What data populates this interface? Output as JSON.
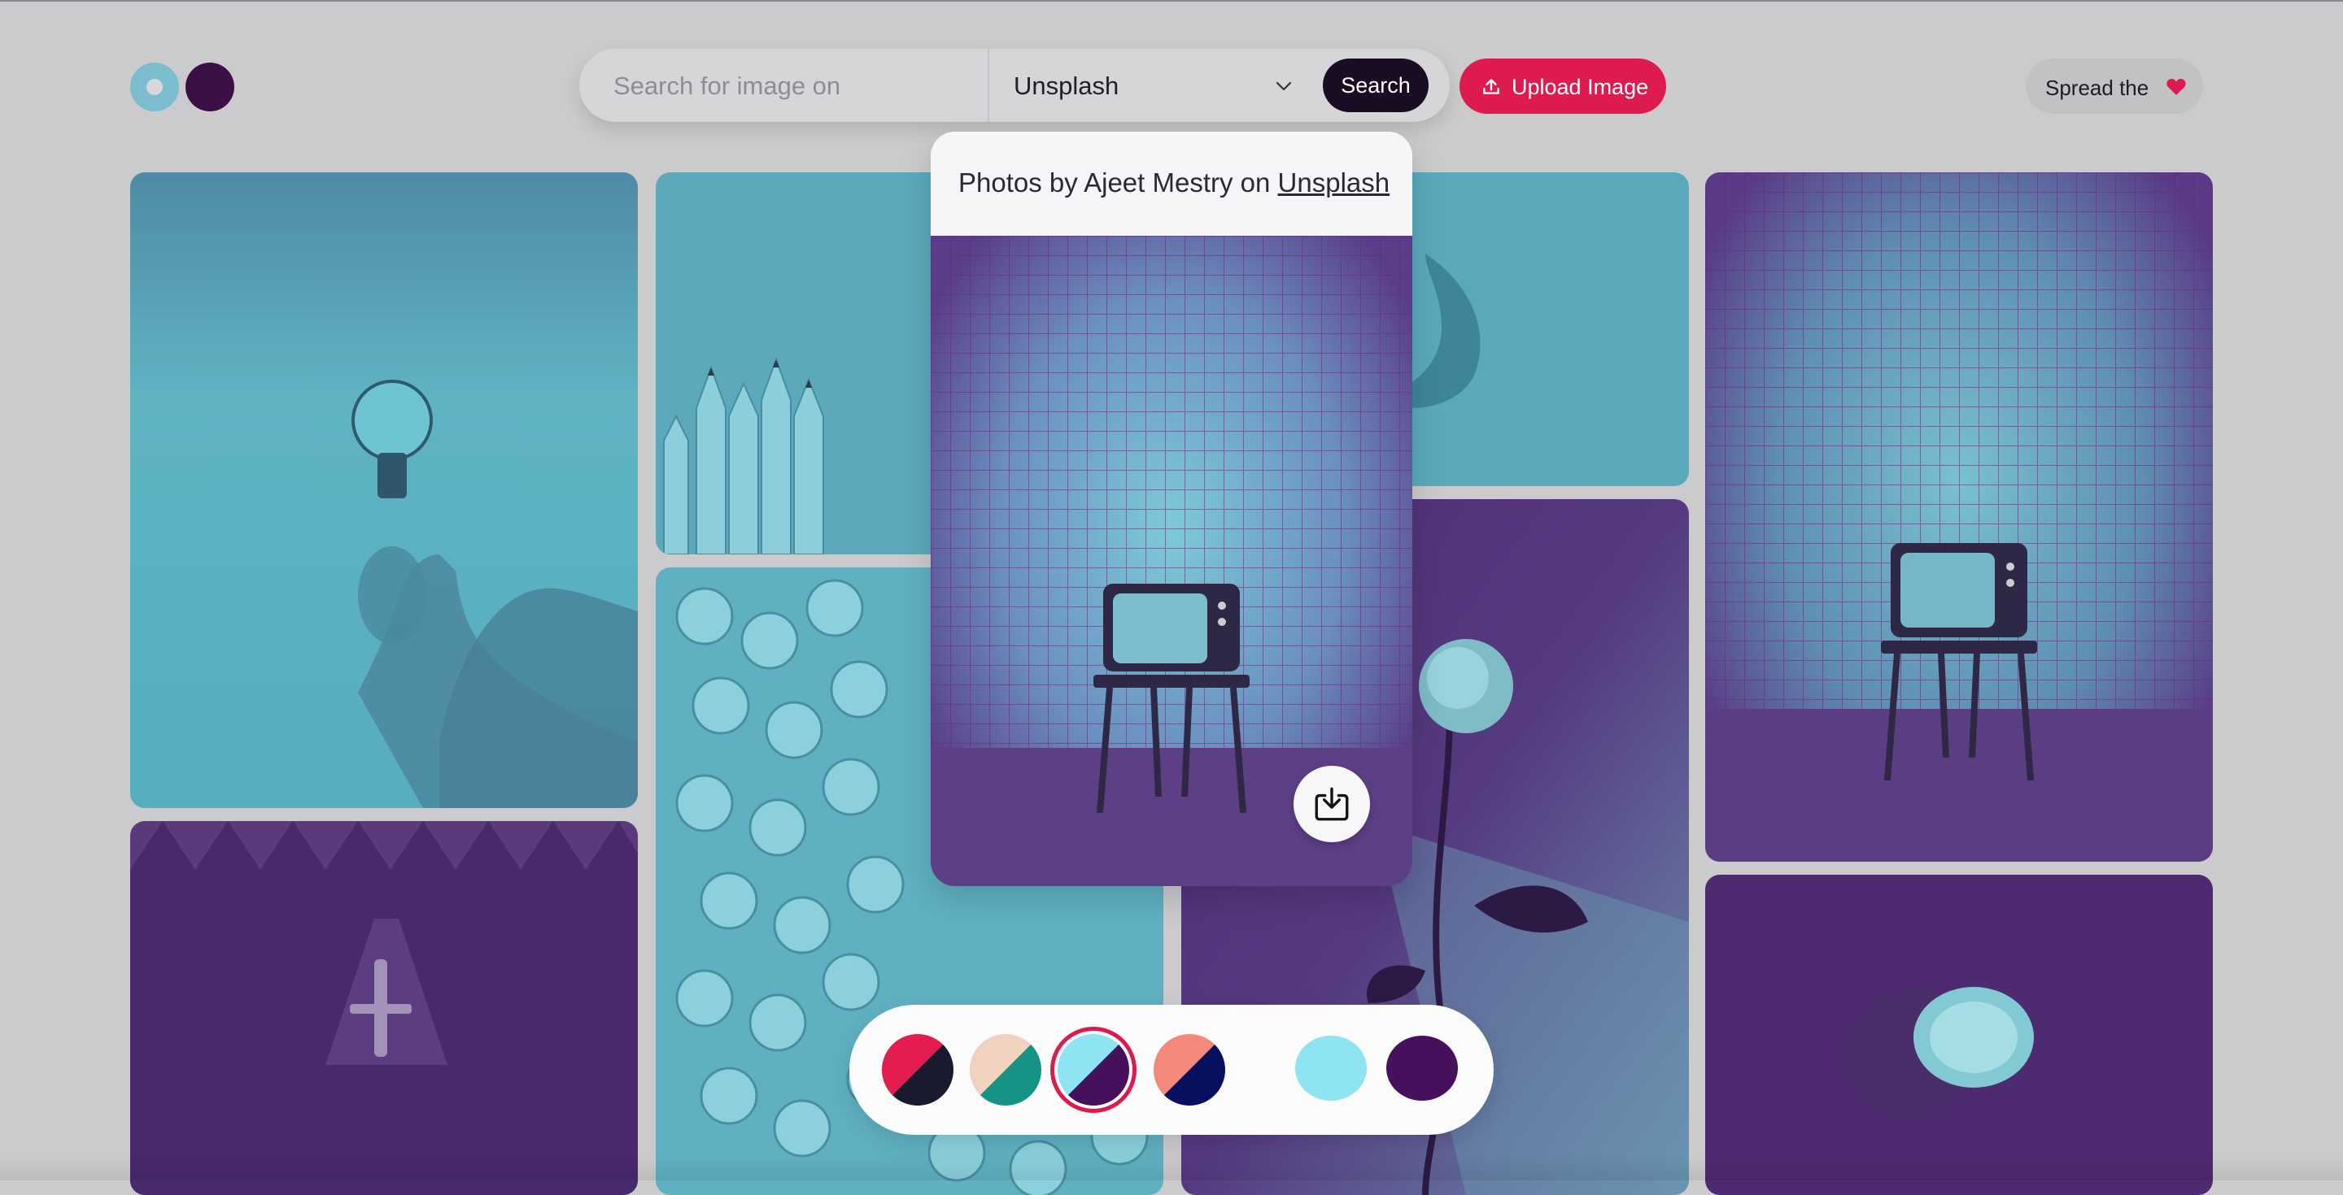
{
  "header": {
    "logo": {
      "colors": [
        "#7bbccf",
        "#3d0f47"
      ]
    },
    "search": {
      "placeholder": "Search for image on",
      "value": ""
    },
    "source_select": {
      "value": "Unsplash",
      "icon": "chevron-down-icon"
    },
    "search_button": "Search",
    "upload_button": {
      "label": "Upload Image",
      "icon": "upload-icon"
    },
    "spread_button": {
      "label": "Spread the",
      "icon": "heart-icon",
      "icon_color": "#dd1b4f"
    }
  },
  "gallery": {
    "duotone": {
      "light": "#8ee4f3",
      "dark": "#46105d"
    },
    "tiles": [
      {
        "name": "lightbulb-hand-photo"
      },
      {
        "name": "airplane-forest-photo"
      },
      {
        "name": "pencils-photo"
      },
      {
        "name": "toy-heads-photo"
      },
      {
        "name": "banana-photo"
      },
      {
        "name": "rose-photo"
      },
      {
        "name": "tv-stand-photo"
      },
      {
        "name": "split-fruit-photo"
      }
    ]
  },
  "preview": {
    "caption_prefix": "Photos by Ajeet Mestry on",
    "caption_link": "Unsplash",
    "download_icon": "download-icon"
  },
  "palette": {
    "selected": "light-blue-purple",
    "presets": [
      {
        "name": "red-dark",
        "colors": [
          "#e31d4d",
          "#1a1a2e"
        ]
      },
      {
        "name": "peach-teal",
        "colors": [
          "#f0d2bf",
          "#159486"
        ]
      },
      {
        "name": "light-blue-purple",
        "colors": [
          "#8ee4f3",
          "#46105d"
        ]
      },
      {
        "name": "salmon-navy",
        "colors": [
          "#f4897b",
          "#07105e"
        ]
      }
    ],
    "custom": [
      "#8ee4f3",
      "#46105d"
    ]
  }
}
